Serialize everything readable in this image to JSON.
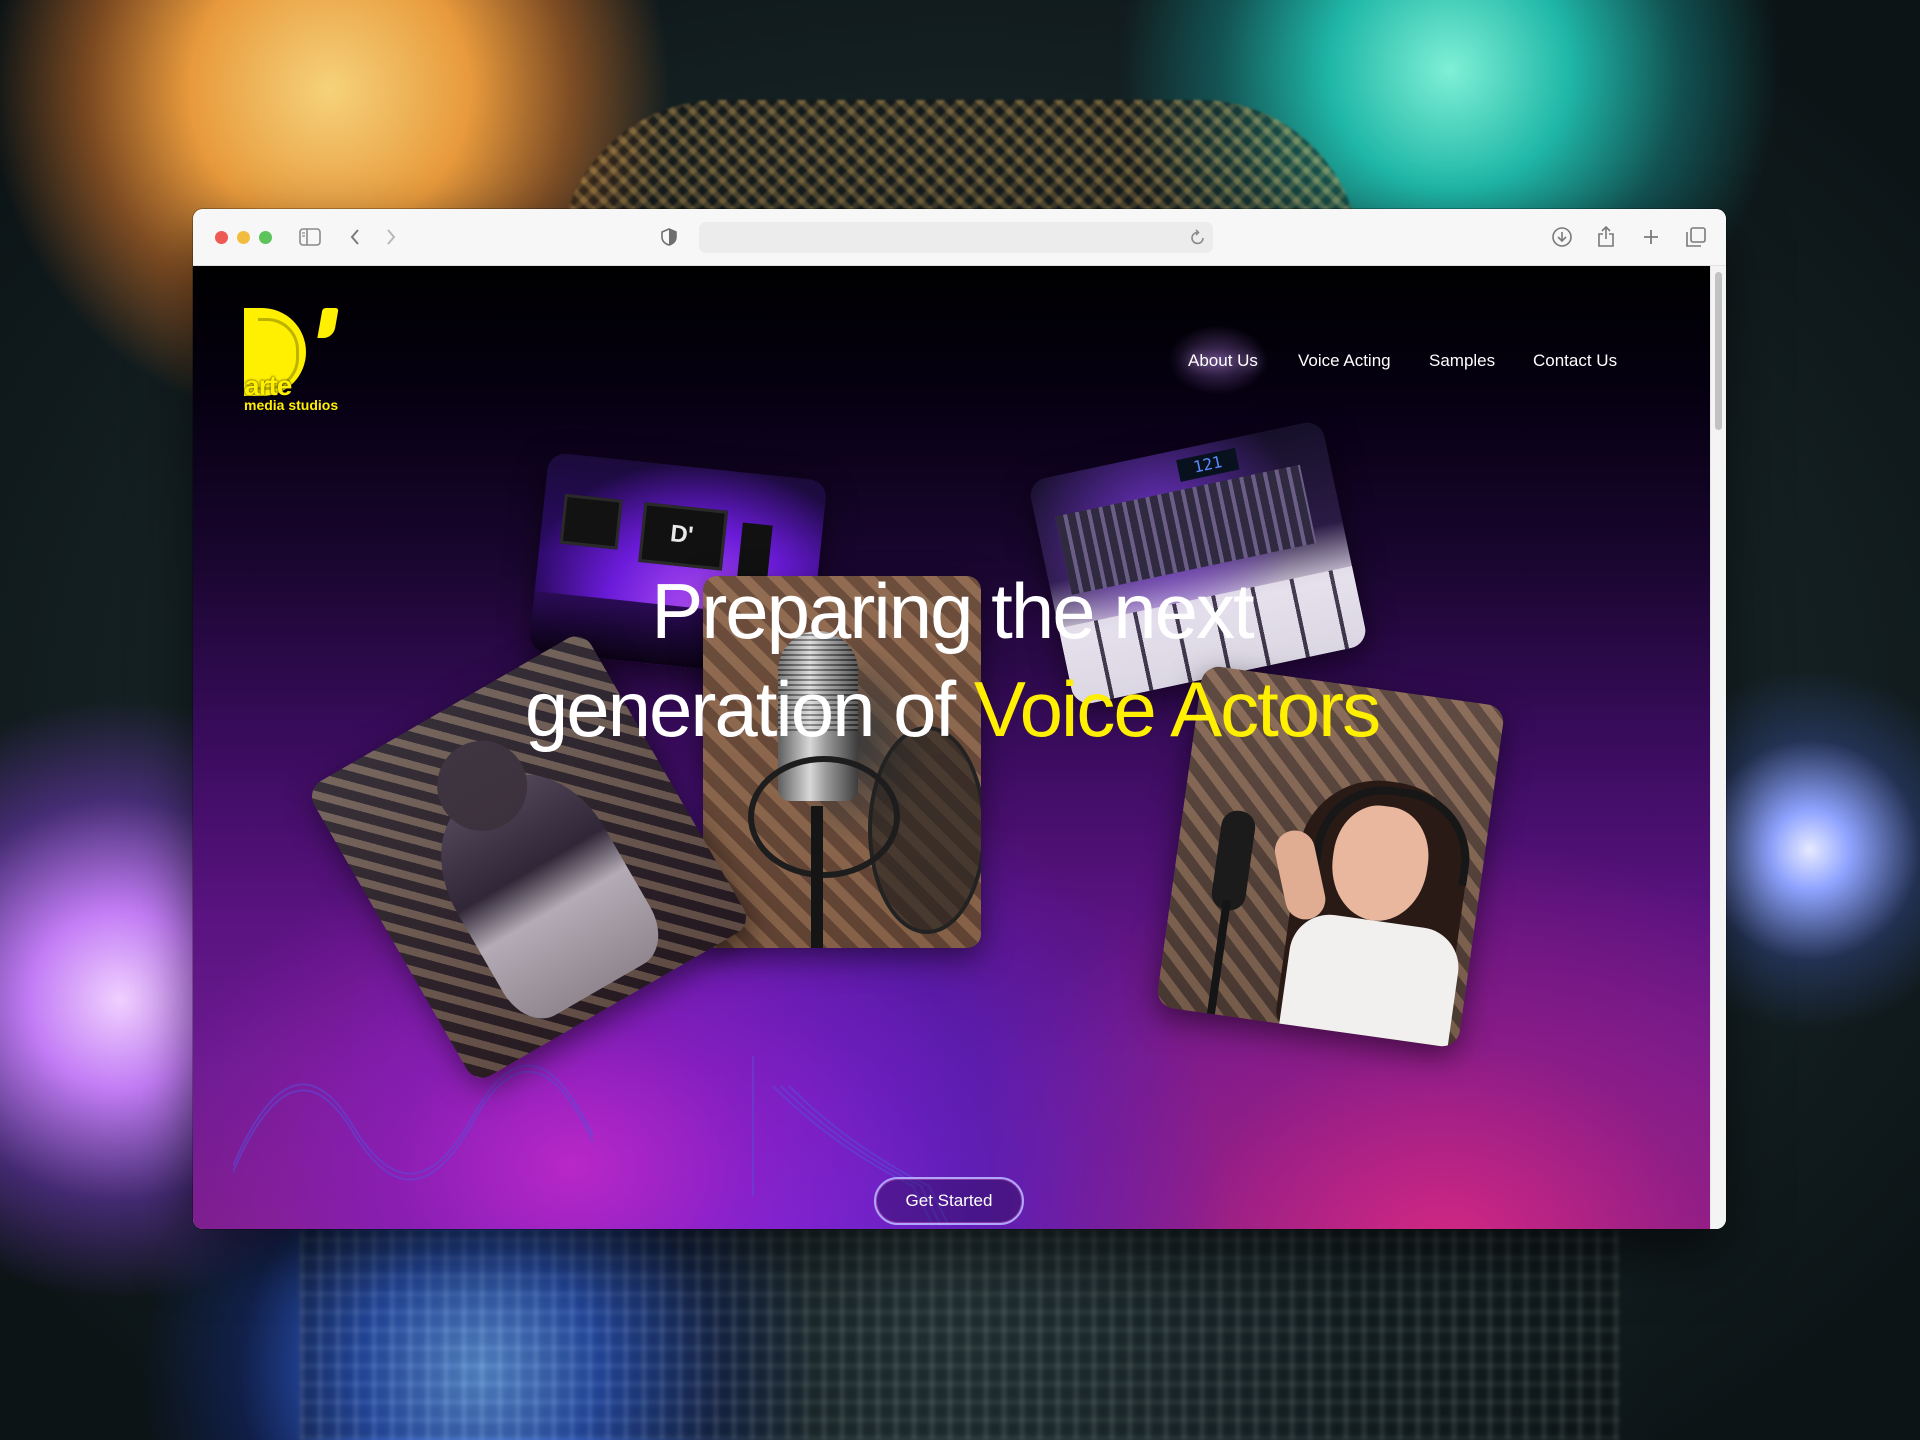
{
  "window": {
    "traffic_lights": {
      "close": "#ee5b55",
      "minimize": "#f2bd3f",
      "zoom": "#5cc45a"
    },
    "toolbar_icons": [
      "sidebar-icon",
      "back-icon",
      "forward-icon",
      "shield-icon",
      "reload-icon",
      "download-icon",
      "share-icon",
      "new-tab-icon",
      "tabs-overview-icon"
    ],
    "url": ""
  },
  "site": {
    "logo": {
      "mark": "D’",
      "word": "arte",
      "tagline": "media studios",
      "color": "#ffef00"
    },
    "nav": [
      {
        "label": "About Us",
        "active": true
      },
      {
        "label": "Voice Acting",
        "active": false
      },
      {
        "label": "Samples",
        "active": false
      },
      {
        "label": "Contact Us",
        "active": false
      }
    ],
    "hero": {
      "line1": "Preparing the next",
      "line2_prefix": "generation of ",
      "line2_accent": "Voice Actors",
      "accent_color": "#ffef00",
      "highlight_color": "#6b1be0"
    },
    "cta_label": "Get Started",
    "mixer_display": "121"
  }
}
